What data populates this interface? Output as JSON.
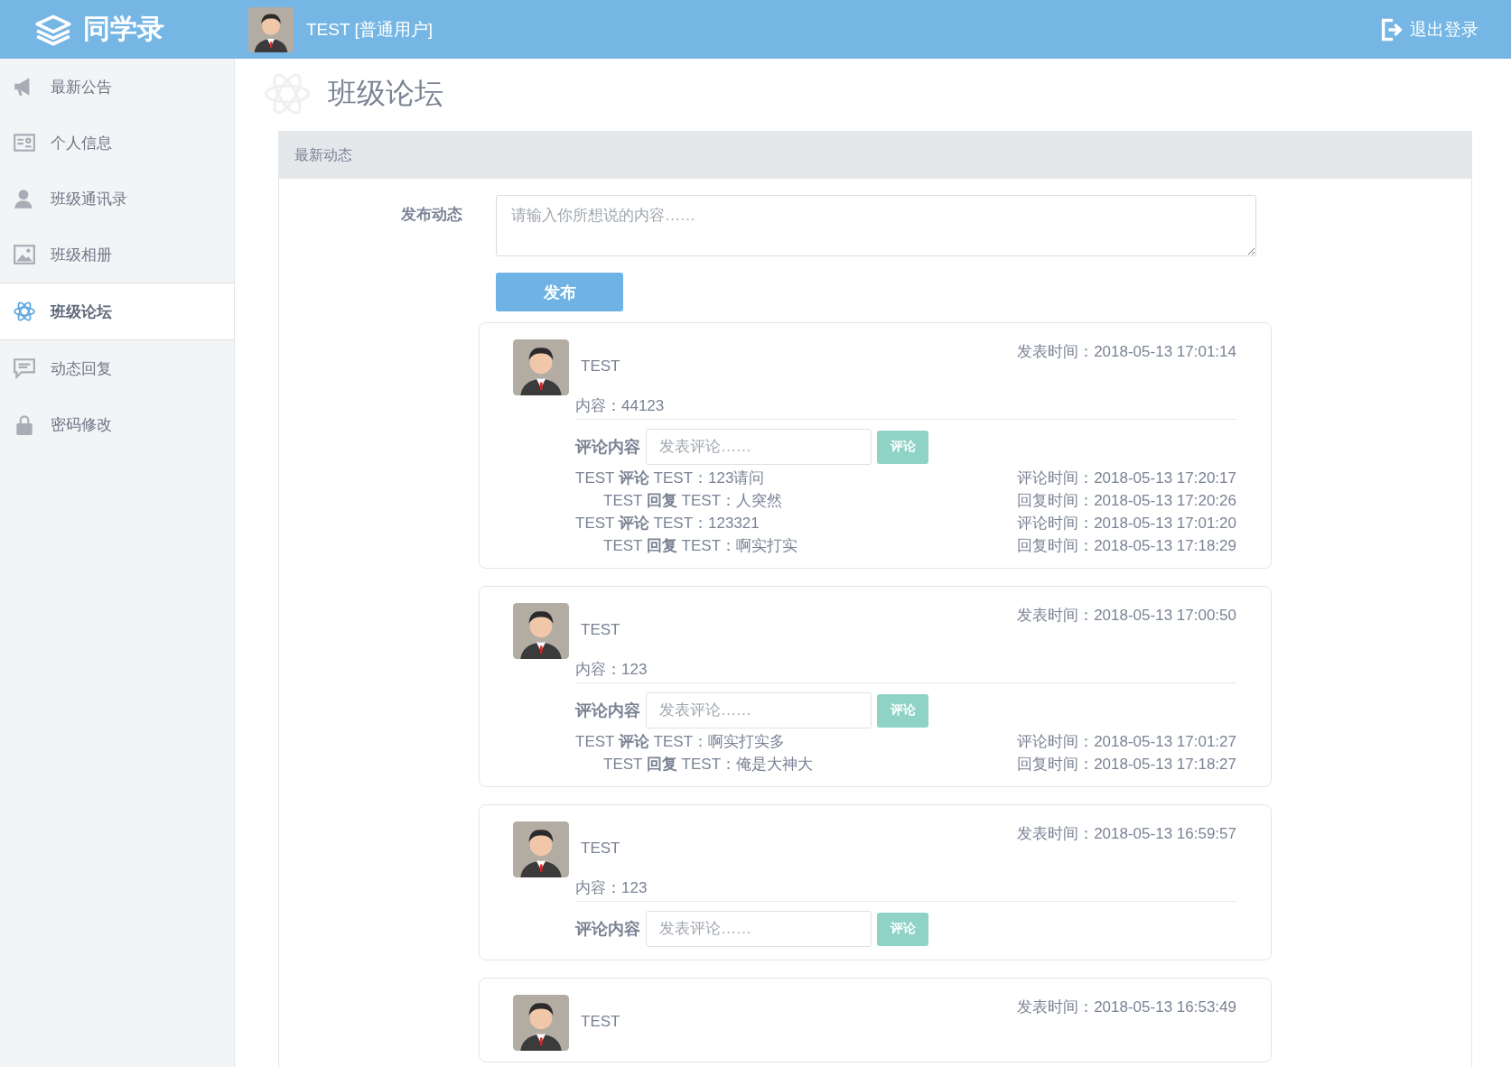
{
  "header": {
    "logo": "同学录",
    "user": "TEST [普通用户]",
    "logout": "退出登录"
  },
  "sidebar": {
    "items": [
      {
        "label": "最新公告",
        "selected": false
      },
      {
        "label": "个人信息",
        "selected": false
      },
      {
        "label": "班级通讯录",
        "selected": false
      },
      {
        "label": "班级相册",
        "selected": false
      },
      {
        "label": "班级论坛",
        "selected": true
      },
      {
        "label": "动态回复",
        "selected": false
      },
      {
        "label": "密码修改",
        "selected": false
      }
    ]
  },
  "page_title": "班级论坛",
  "panel": {
    "heading": "最新动态",
    "publish_label": "发布动态",
    "publish_placeholder": "请输入你所想说的内容……",
    "publish_button": "发布",
    "posts": [
      {
        "author": "TEST",
        "time": "发表时间：2018-05-13 17:01:14",
        "content": "内容：44123",
        "comment_label": "评论内容",
        "comment_placeholder": "发表评论……",
        "comment_button": "评论",
        "comments": [
          {
            "text": "TEST **评论** TEST：123请问",
            "time": "评论时间：2018-05-13 17:20:17",
            "children": [
              {
                "text": "TEST **回复** TEST：人突然",
                "time": "回复时间：2018-05-13 17:20:26"
              }
            ]
          },
          {
            "text": "TEST **评论** TEST：123321",
            "time": "评论时间：2018-05-13 17:01:20",
            "children": [
              {
                "text": "TEST **回复** TEST：啊实打实",
                "time": "回复时间：2018-05-13 17:18:29"
              }
            ]
          }
        ]
      },
      {
        "author": "TEST",
        "time": "发表时间：2018-05-13 17:00:50",
        "content": "内容：123",
        "comment_label": "评论内容",
        "comment_placeholder": "发表评论……",
        "comment_button": "评论",
        "comments": [
          {
            "text": "TEST **评论** TEST：啊实打实多",
            "time": "评论时间：2018-05-13 17:01:27",
            "children": [
              {
                "text": "TEST **回复** TEST：俺是大神大",
                "time": "回复时间：2018-05-13 17:18:27"
              }
            ]
          }
        ]
      },
      {
        "author": "TEST",
        "time": "发表时间：2018-05-13 16:59:57",
        "content": "内容：123",
        "comment_label": "评论内容",
        "comment_placeholder": "发表评论……",
        "comment_button": "评论"
      },
      {
        "author": "TEST",
        "time": "发表时间：2018-05-13 16:53:49"
      }
    ]
  }
}
